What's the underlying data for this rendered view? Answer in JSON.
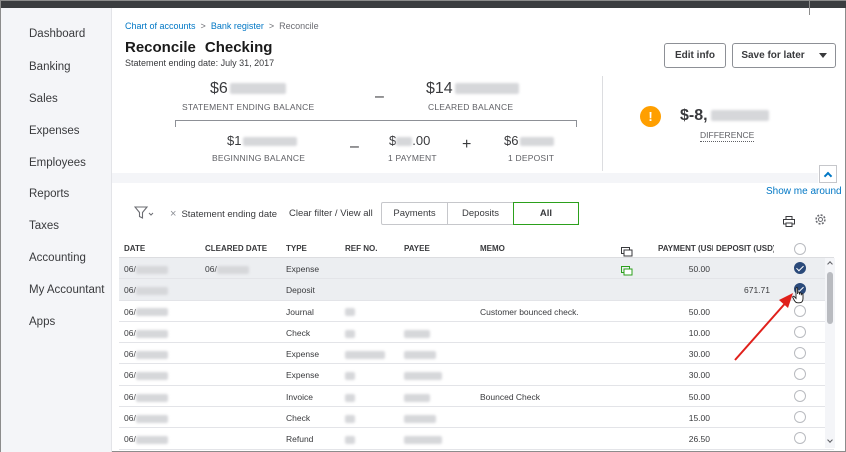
{
  "sidebar": {
    "items": [
      {
        "label": "Dashboard"
      },
      {
        "label": "Banking"
      },
      {
        "label": "Sales"
      },
      {
        "label": "Expenses"
      },
      {
        "label": "Employees"
      },
      {
        "label": "Reports"
      },
      {
        "label": "Taxes"
      },
      {
        "label": "Accounting"
      },
      {
        "label": "My Accountant"
      },
      {
        "label": "Apps"
      }
    ]
  },
  "breadcrumb": {
    "chart_of_accounts": "Chart of accounts",
    "sep": ">",
    "bank_register": "Bank register",
    "current": "Reconcile"
  },
  "header": {
    "title": "Reconcile",
    "account": "Checking",
    "statement_date": "Statement ending date: July 31, 2017",
    "edit_info": "Edit info",
    "save_for_later": "Save for later"
  },
  "summary": {
    "statement_ending_balance_prefix": "$6",
    "statement_ending_balance_label": "STATEMENT ENDING BALANCE",
    "minus": "–",
    "cleared_balance_prefix": "$14",
    "cleared_balance_label": "CLEARED BALANCE",
    "beginning_balance_prefix": "$1",
    "beginning_balance_label": "BEGINNING BALANCE",
    "payment_prefix": "$",
    "payment_suffix": ".00",
    "payment_label": "1 PAYMENT",
    "plus": "+",
    "deposit_prefix": "$6",
    "deposit_label": "1 DEPOSIT",
    "difference_prefix": "$-8,",
    "difference_label": "DIFFERENCE",
    "warning_glyph": "!"
  },
  "toolbar": {
    "show_me_around": "Show me around",
    "filter_chip": "Statement ending date",
    "filter_chip_close": "×",
    "clear_filter": "Clear filter / View all",
    "tabs": [
      "Payments",
      "Deposits",
      "All"
    ],
    "active_tab": "All"
  },
  "table": {
    "columns": [
      "DATE",
      "CLEARED DATE",
      "TYPE",
      "REF NO.",
      "PAYEE",
      "MEMO",
      "PAYMENT (USD)",
      "DEPOSIT (USD)"
    ],
    "rows": [
      {
        "date": "06/",
        "cleared": "06/",
        "type": "Expense",
        "memo": "",
        "payment": "50.00",
        "deposit": "",
        "checked": true,
        "memo_icon": true
      },
      {
        "date": "06/",
        "cleared": "",
        "type": "Deposit",
        "memo": "",
        "payment": "",
        "deposit": "671.71",
        "checked": true,
        "memo_icon": false
      },
      {
        "date": "06/",
        "cleared": "",
        "type": "Journal",
        "memo": "Customer bounced check.",
        "payment": "50.00",
        "deposit": "",
        "checked": false,
        "memo_icon": false
      },
      {
        "date": "06/",
        "cleared": "",
        "type": "Check",
        "memo": "",
        "payment": "10.00",
        "deposit": "",
        "checked": false,
        "memo_icon": false
      },
      {
        "date": "06/",
        "cleared": "",
        "type": "Expense",
        "memo": "",
        "payment": "30.00",
        "deposit": "",
        "checked": false,
        "memo_icon": false
      },
      {
        "date": "06/",
        "cleared": "",
        "type": "Expense",
        "memo": "",
        "payment": "30.00",
        "deposit": "",
        "checked": false,
        "memo_icon": false
      },
      {
        "date": "06/",
        "cleared": "",
        "type": "Invoice",
        "memo": "Bounced Check",
        "payment": "50.00",
        "deposit": "",
        "checked": false,
        "memo_icon": false
      },
      {
        "date": "06/",
        "cleared": "",
        "type": "Check",
        "memo": "",
        "payment": "15.00",
        "deposit": "",
        "checked": false,
        "memo_icon": false
      },
      {
        "date": "06/",
        "cleared": "",
        "type": "Refund",
        "memo": "",
        "payment": "26.50",
        "deposit": "",
        "checked": false,
        "memo_icon": false
      }
    ]
  },
  "colors": {
    "link": "#0077c5",
    "active_tab": "#2ca01c",
    "warning": "#ff9f00",
    "checked": "#2b4a7a",
    "arrow": "#e0201b"
  }
}
